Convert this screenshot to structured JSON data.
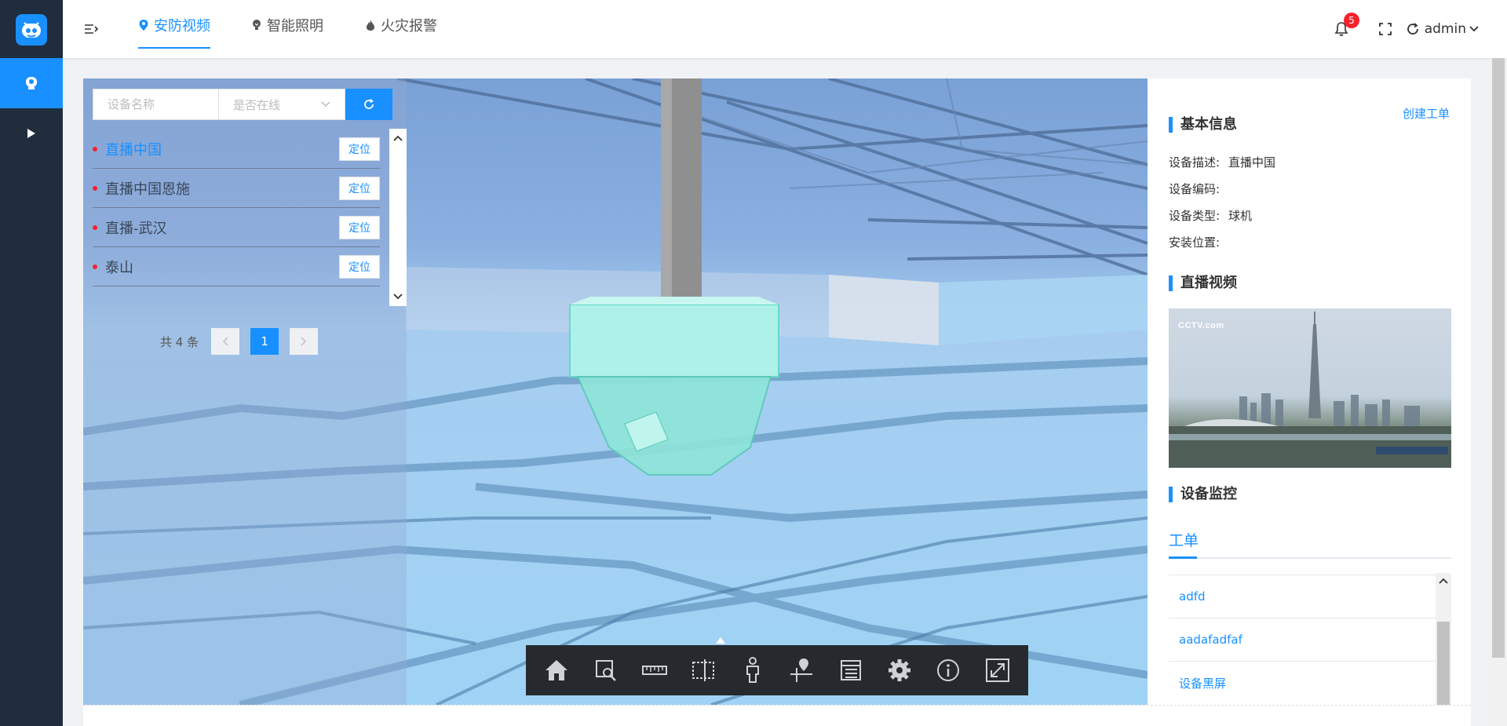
{
  "nav": {
    "tabs": [
      {
        "label": "安防视频",
        "icon": "location-pin-icon",
        "active": true
      },
      {
        "label": "智能照明",
        "icon": "bulb-icon",
        "active": false
      },
      {
        "label": "火灾报警",
        "icon": "flame-icon",
        "active": false
      }
    ],
    "notification_count": "5",
    "user": "admin"
  },
  "sidebar": {
    "items": [
      {
        "icon": "camera-icon",
        "active": true
      },
      {
        "icon": "play-icon",
        "active": false
      }
    ]
  },
  "device_panel": {
    "search_placeholder": "设备名称",
    "online_placeholder": "是否在线",
    "devices": [
      {
        "name": "直播中国",
        "action": "定位",
        "active": true
      },
      {
        "name": "直播中国恩施",
        "action": "定位",
        "active": false
      },
      {
        "name": "直播-武汉",
        "action": "定位",
        "active": false
      },
      {
        "name": "泰山",
        "action": "定位",
        "active": false
      }
    ],
    "pagination": {
      "total_text": "共 4 条",
      "current_page": "1"
    }
  },
  "toolbar": {
    "icons": [
      "home-icon",
      "zoom-area-icon",
      "ruler-icon",
      "split-view-icon",
      "person-icon",
      "map-pin-icon",
      "list-icon",
      "gear-icon",
      "info-icon",
      "expand-icon"
    ]
  },
  "info_panel": {
    "create_link": "创建工单",
    "basic_title": "基本信息",
    "fields": [
      {
        "label": "设备描述:",
        "value": "直播中国"
      },
      {
        "label": "设备编码:",
        "value": ""
      },
      {
        "label": "设备类型:",
        "value": "球机"
      },
      {
        "label": "安装位置:",
        "value": ""
      }
    ],
    "video_title": "直播视频",
    "video_logo": "CCTV.com",
    "monitor_title": "设备监控",
    "workorder_tab": "工单",
    "workorders": [
      "adfd",
      "aadafadfaf",
      "设备黑屏"
    ]
  },
  "colors": {
    "primary": "#1890ff",
    "rail": "#1f2d3d",
    "badge": "#f5222d",
    "toolbar": "#262a2f"
  }
}
